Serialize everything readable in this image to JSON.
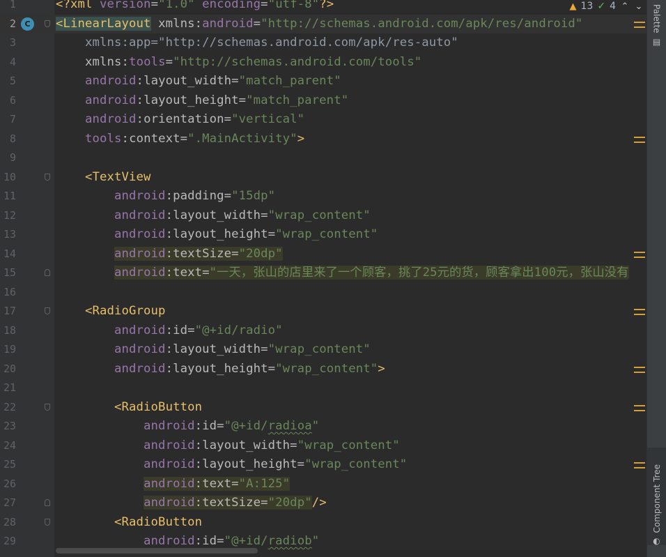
{
  "inspections": {
    "warnings": "13",
    "ok": "4"
  },
  "right_tabs": {
    "palette": "Palette",
    "component_tree": "Component Tree"
  },
  "lines": [
    {
      "n": "1",
      "tokens": [
        [
          "pi",
          "<?xml "
        ],
        [
          "an",
          "version"
        ],
        [
          "eq",
          "="
        ],
        [
          "val",
          "\"1.0\""
        ],
        [
          "eq",
          " "
        ],
        [
          "an",
          "encoding"
        ],
        [
          "eq",
          "="
        ],
        [
          "val",
          "\"utf-8\""
        ],
        [
          "pi",
          "?>"
        ]
      ]
    },
    {
      "n": "2",
      "tokens": [
        [
          "tag tagmatch",
          "<LinearLayout"
        ],
        [
          "nm",
          " xmlns"
        ],
        [
          "eq",
          ":"
        ],
        [
          "an",
          "android"
        ],
        [
          "eq",
          "="
        ],
        [
          "val",
          "\"http://schemas.android.com/apk/res/android\""
        ]
      ]
    },
    {
      "n": "3",
      "tokens": [
        [
          "dim",
          "    xmlns:app=\"http://schemas.android.com/apk/res-auto\""
        ]
      ]
    },
    {
      "n": "4",
      "tokens": [
        [
          "nm",
          "    xmlns"
        ],
        [
          "eq",
          ":"
        ],
        [
          "an",
          "tools"
        ],
        [
          "eq",
          "="
        ],
        [
          "val",
          "\"http://schemas.android.com/tools\""
        ]
      ]
    },
    {
      "n": "5",
      "tokens": [
        [
          "an",
          "    android"
        ],
        [
          "eq",
          ":"
        ],
        [
          "nm",
          "layout_width"
        ],
        [
          "eq",
          "="
        ],
        [
          "val",
          "\"match_parent\""
        ]
      ]
    },
    {
      "n": "6",
      "tokens": [
        [
          "an",
          "    android"
        ],
        [
          "eq",
          ":"
        ],
        [
          "nm",
          "layout_height"
        ],
        [
          "eq",
          "="
        ],
        [
          "val",
          "\"match_parent\""
        ]
      ]
    },
    {
      "n": "7",
      "tokens": [
        [
          "an",
          "    android"
        ],
        [
          "eq",
          ":"
        ],
        [
          "nm",
          "orientation"
        ],
        [
          "eq",
          "="
        ],
        [
          "val",
          "\"vertical\""
        ]
      ]
    },
    {
      "n": "8",
      "tokens": [
        [
          "an",
          "    tools"
        ],
        [
          "eq",
          ":"
        ],
        [
          "nm",
          "context"
        ],
        [
          "eq",
          "="
        ],
        [
          "val",
          "\".MainActivity\""
        ],
        [
          "tag",
          ">"
        ]
      ]
    },
    {
      "n": "9",
      "tokens": []
    },
    {
      "n": "10",
      "tokens": [
        [
          "tag",
          "    <TextView"
        ]
      ]
    },
    {
      "n": "11",
      "tokens": [
        [
          "an",
          "        android"
        ],
        [
          "eq",
          ":"
        ],
        [
          "nm",
          "padding"
        ],
        [
          "eq",
          "="
        ],
        [
          "val",
          "\"15dp\""
        ]
      ]
    },
    {
      "n": "12",
      "tokens": [
        [
          "an",
          "        android"
        ],
        [
          "eq",
          ":"
        ],
        [
          "nm",
          "layout_width"
        ],
        [
          "eq",
          "="
        ],
        [
          "val",
          "\"wrap_content\""
        ]
      ]
    },
    {
      "n": "13",
      "tokens": [
        [
          "an",
          "        android"
        ],
        [
          "eq",
          ":"
        ],
        [
          "nm",
          "layout_height"
        ],
        [
          "eq",
          "="
        ],
        [
          "val",
          "\"wrap_content\""
        ]
      ]
    },
    {
      "n": "14",
      "tokens": [
        [
          "eq",
          "        "
        ],
        [
          "an hl",
          "android"
        ],
        [
          "eq hl",
          ":"
        ],
        [
          "nm hl",
          "textSize"
        ],
        [
          "eq hl",
          "="
        ],
        [
          "val hl",
          "\"20dp\""
        ]
      ]
    },
    {
      "n": "15",
      "tokens": [
        [
          "eq",
          "        "
        ],
        [
          "an hl",
          "android"
        ],
        [
          "eq hl",
          ":"
        ],
        [
          "nm hl",
          "text"
        ],
        [
          "eq hl",
          "="
        ],
        [
          "val hl",
          "\"一天，张山的店里来了一个顾客，挑了25元的货，顾客拿出100元，张山没有"
        ]
      ]
    },
    {
      "n": "16",
      "tokens": []
    },
    {
      "n": "17",
      "tokens": [
        [
          "tag",
          "    <RadioGroup"
        ]
      ]
    },
    {
      "n": "18",
      "tokens": [
        [
          "an",
          "        android"
        ],
        [
          "eq",
          ":"
        ],
        [
          "nm",
          "id"
        ],
        [
          "eq",
          "="
        ],
        [
          "val",
          "\"@+id/radio\""
        ]
      ]
    },
    {
      "n": "19",
      "tokens": [
        [
          "an",
          "        android"
        ],
        [
          "eq",
          ":"
        ],
        [
          "nm",
          "layout_width"
        ],
        [
          "eq",
          "="
        ],
        [
          "val",
          "\"wrap_content\""
        ]
      ]
    },
    {
      "n": "20",
      "tokens": [
        [
          "an",
          "        android"
        ],
        [
          "eq",
          ":"
        ],
        [
          "nm",
          "layout_height"
        ],
        [
          "eq",
          "="
        ],
        [
          "val",
          "\"wrap_content\""
        ],
        [
          "tag",
          ">"
        ]
      ]
    },
    {
      "n": "21",
      "tokens": []
    },
    {
      "n": "22",
      "tokens": [
        [
          "tag",
          "        <RadioButton"
        ]
      ]
    },
    {
      "n": "23",
      "tokens": [
        [
          "an",
          "            android"
        ],
        [
          "eq",
          ":"
        ],
        [
          "nm",
          "id"
        ],
        [
          "eq",
          "="
        ],
        [
          "val",
          "\"@+id/"
        ],
        [
          "val sq",
          "radioa"
        ],
        [
          "val",
          "\""
        ]
      ]
    },
    {
      "n": "24",
      "tokens": [
        [
          "an",
          "            android"
        ],
        [
          "eq",
          ":"
        ],
        [
          "nm",
          "layout_width"
        ],
        [
          "eq",
          "="
        ],
        [
          "val",
          "\"wrap_content\""
        ]
      ]
    },
    {
      "n": "25",
      "tokens": [
        [
          "an",
          "            android"
        ],
        [
          "eq",
          ":"
        ],
        [
          "nm",
          "layout_height"
        ],
        [
          "eq",
          "="
        ],
        [
          "val",
          "\"wrap_content\""
        ]
      ]
    },
    {
      "n": "26",
      "tokens": [
        [
          "eq",
          "            "
        ],
        [
          "an hl",
          "android"
        ],
        [
          "eq hl",
          ":"
        ],
        [
          "nm hl",
          "text"
        ],
        [
          "eq hl",
          "="
        ],
        [
          "val hl",
          "\"A:125\""
        ]
      ]
    },
    {
      "n": "27",
      "tokens": [
        [
          "eq",
          "            "
        ],
        [
          "an hl",
          "android"
        ],
        [
          "eq hl",
          ":"
        ],
        [
          "nm hl",
          "textSize"
        ],
        [
          "eq hl",
          "="
        ],
        [
          "val hl",
          "\"20dp\""
        ],
        [
          "tag",
          "/>"
        ]
      ]
    },
    {
      "n": "28",
      "tokens": [
        [
          "tag",
          "        <RadioButton"
        ]
      ]
    },
    {
      "n": "29",
      "tokens": [
        [
          "an",
          "            android"
        ],
        [
          "eq",
          ":"
        ],
        [
          "nm",
          "id"
        ],
        [
          "eq",
          "="
        ],
        [
          "val",
          "\"@+id/"
        ],
        [
          "val sq",
          "radiob"
        ],
        [
          "val",
          "\""
        ]
      ]
    }
  ]
}
